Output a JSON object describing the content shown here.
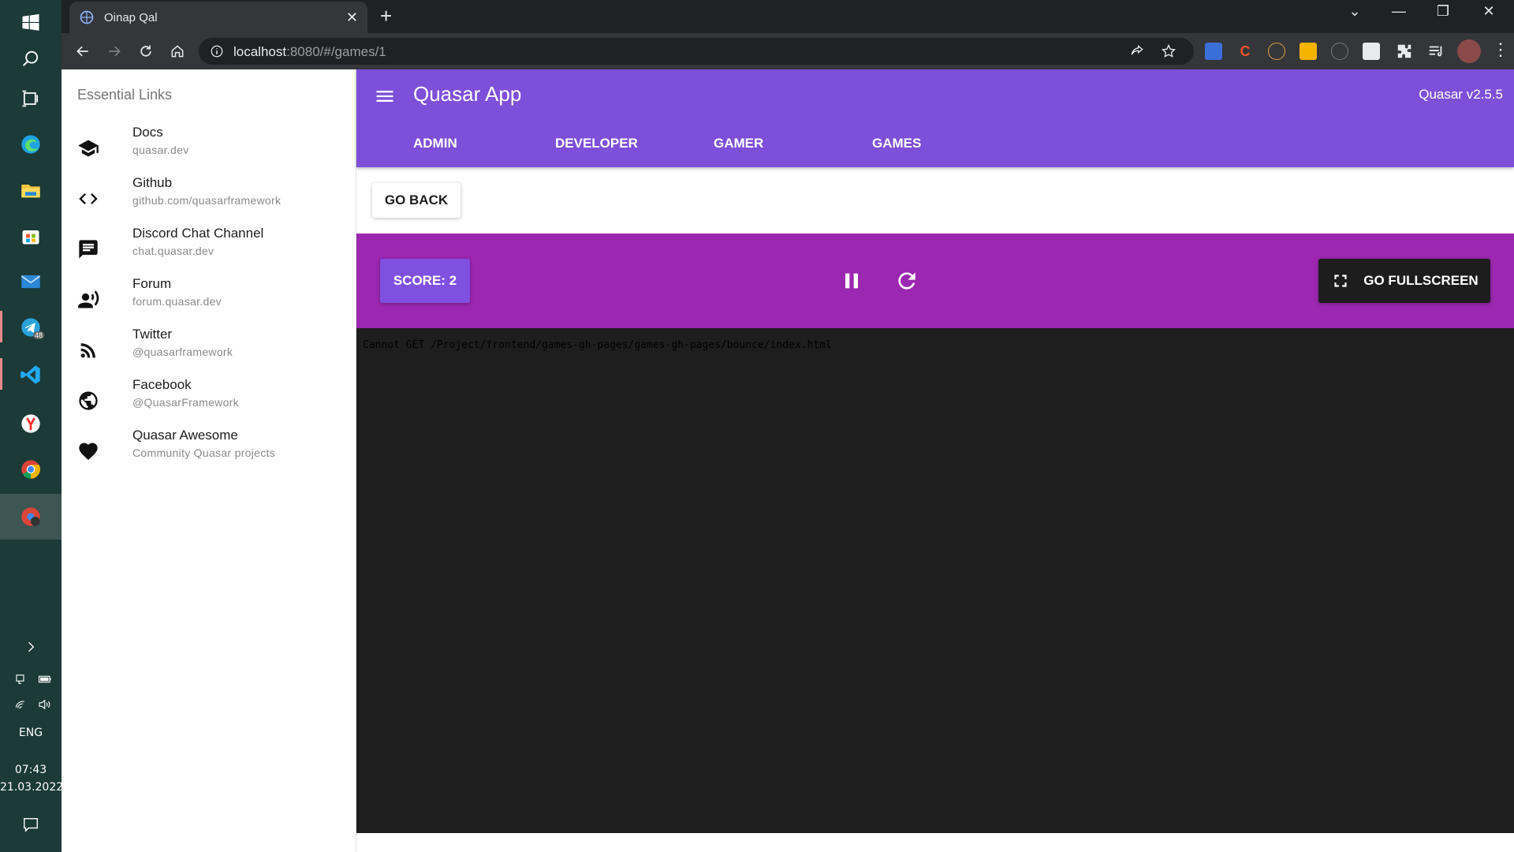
{
  "taskbar": {
    "icons": [
      "windows-start-icon",
      "search-icon",
      "task-view-icon",
      "edge-icon",
      "file-explorer-icon",
      "store-icon",
      "mail-icon",
      "telegram-icon",
      "vscode-icon",
      "yandex-icon",
      "chrome-icon",
      "chrome-profile-icon"
    ],
    "telegram_badge": "48",
    "language": "ENG",
    "time": "07:43",
    "date": "21.03.2022"
  },
  "browser": {
    "tab_title": "Oinap Qal",
    "url_host": "localhost",
    "url_path": ":8080/#/games/1"
  },
  "drawer": {
    "header": "Essential Links",
    "links": [
      {
        "title": "Docs",
        "caption": "quasar.dev",
        "icon": "school-icon"
      },
      {
        "title": "Github",
        "caption": "github.com/quasarframework",
        "icon": "code-icon"
      },
      {
        "title": "Discord Chat Channel",
        "caption": "chat.quasar.dev",
        "icon": "chat-icon"
      },
      {
        "title": "Forum",
        "caption": "forum.quasar.dev",
        "icon": "record-voice-icon"
      },
      {
        "title": "Twitter",
        "caption": "@quasarframework",
        "icon": "rss-feed-icon"
      },
      {
        "title": "Facebook",
        "caption": "@QuasarFramework",
        "icon": "public-icon"
      },
      {
        "title": "Quasar Awesome",
        "caption": "Community Quasar projects",
        "icon": "favorite-icon"
      }
    ]
  },
  "header": {
    "title": "Quasar App",
    "version": "Quasar v2.5.5",
    "tabs": [
      "ADMIN",
      "DEVELOPER",
      "GAMER",
      "GAMES"
    ]
  },
  "content": {
    "go_back": "GO BACK",
    "score": "SCORE: 2",
    "fullscreen": "GO FULLSCREEN",
    "error": "Cannot GET /Project/frontend/games-gh-pages/games-gh-pages/bounce/index.html"
  },
  "colors": {
    "primary": "#7e4fd8",
    "game_bar": "#9c27b0",
    "score_button": "#8050e0",
    "dark_button": "#1d1d1d",
    "frame_bg": "#1e1e1e"
  }
}
